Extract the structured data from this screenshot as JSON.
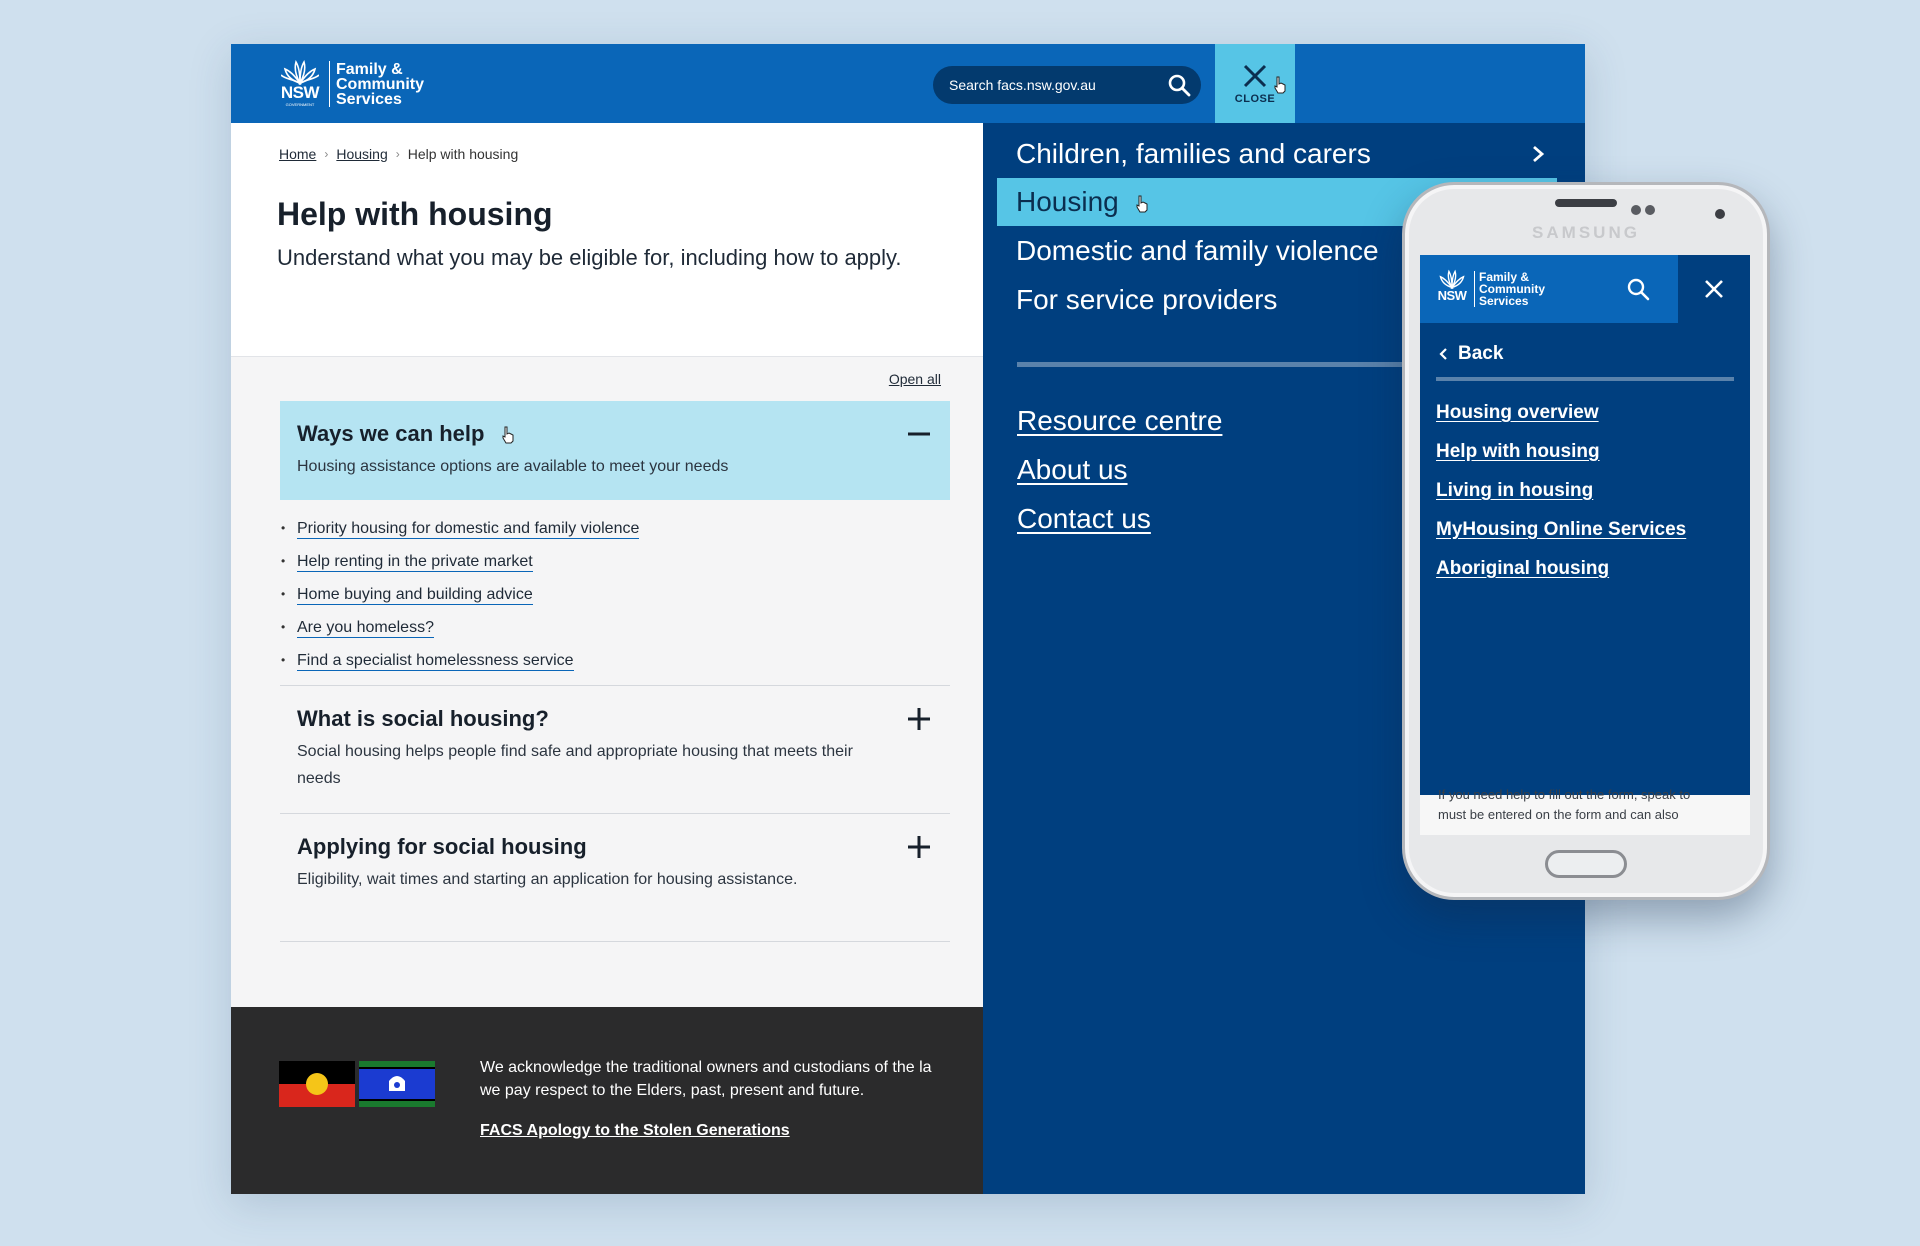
{
  "header": {
    "logo": {
      "mark": "NSW",
      "gov": "GOVERNMENT",
      "line1": "Family &",
      "line2": "Community",
      "line3": "Services"
    },
    "search_placeholder": "Search facs.nsw.gov.au",
    "close_label": "CLOSE"
  },
  "breadcrumb": [
    "Home",
    "Housing",
    "Help with housing"
  ],
  "breadcrumb_sep": "›",
  "page": {
    "title": "Help with housing",
    "intro": "Understand what you may be eligible for, including how to apply."
  },
  "accordion": {
    "open_all": "Open all",
    "items": [
      {
        "title": "Ways we can help",
        "desc": "Housing assistance options are available to meet your needs",
        "state": "open"
      },
      {
        "title": "What is social housing?",
        "desc": "Social housing helps people find safe and appropriate housing that meets their needs",
        "state": "closed"
      },
      {
        "title": "Applying for social housing",
        "desc": "Eligibility, wait times and starting an application for housing assistance.",
        "state": "closed"
      }
    ],
    "links": [
      "Priority housing for domestic and family violence",
      "Help renting in the private market",
      "Home buying and building advice",
      "Are you homeless?",
      "Find a specialist homelessness service"
    ]
  },
  "footer": {
    "acknowledgement_line1": "We acknowledge the traditional owners and custodians of the la",
    "acknowledgement_line2": "we pay respect to the Elders, past, present and future.",
    "apology_link": "FACS Apology to the Stolen Generations"
  },
  "menu": {
    "primary": [
      "Children, families and carers",
      "Housing",
      "Domestic and family violence",
      "For service providers"
    ],
    "active": "Housing",
    "secondary": [
      "Resource centre",
      "About us",
      "Contact us"
    ]
  },
  "phone": {
    "brand": "SAMSUNG",
    "back_label": "Back",
    "links": [
      "Housing overview",
      "Help with housing",
      "Living in housing",
      "MyHousing Online Services",
      "Aboriginal housing"
    ],
    "peek_line1": "If you need help to fill out the form, speak to",
    "peek_line2": "must be entered on the form and can also"
  },
  "colors": {
    "header_blue": "#0a66b8",
    "navy": "#003f7f",
    "highlight": "#56c5e6",
    "accordion_open": "#b5e4f2",
    "footer": "#2b2b2c"
  }
}
